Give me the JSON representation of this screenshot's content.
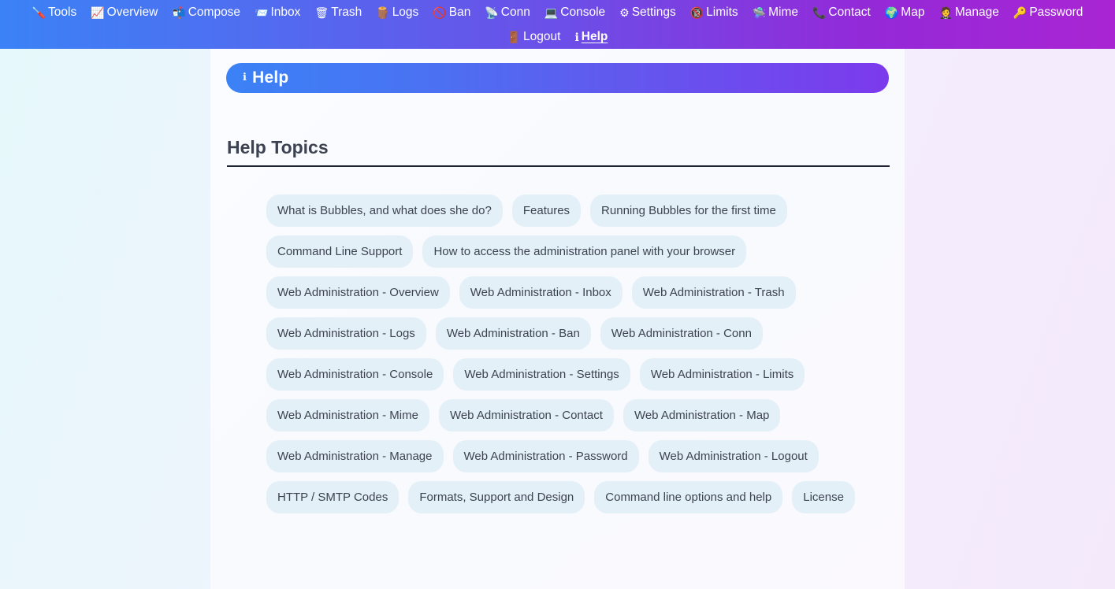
{
  "nav": {
    "row1": [
      {
        "icon": "screwdriver-icon",
        "glyph": "🪛",
        "label": "Tools"
      },
      {
        "icon": "chart-increasing-icon",
        "glyph": "📈",
        "label": "Overview"
      },
      {
        "icon": "open-mailbox-icon",
        "glyph": "📬",
        "label": "Compose"
      },
      {
        "icon": "incoming-envelope-icon",
        "glyph": "📨",
        "label": "Inbox"
      },
      {
        "icon": "wastebasket-icon",
        "glyph": "🗑",
        "label": "Trash"
      },
      {
        "icon": "wood-log-icon",
        "glyph": "🪵",
        "label": "Logs"
      },
      {
        "icon": "prohibited-icon",
        "glyph": "🚫",
        "label": "Ban"
      },
      {
        "icon": "satellite-antenna-icon",
        "glyph": "📡",
        "label": "Conn"
      },
      {
        "icon": "laptop-icon",
        "glyph": "💻",
        "label": "Console"
      },
      {
        "icon": "gear-icon",
        "glyph": "⚙",
        "label": "Settings"
      },
      {
        "icon": "no-one-under-eighteen-icon",
        "glyph": "🔞",
        "label": "Limits"
      },
      {
        "icon": "flying-saucer-icon",
        "glyph": "🛸",
        "label": "Mime"
      },
      {
        "icon": "telephone-receiver-icon",
        "glyph": "📞",
        "label": "Contact"
      },
      {
        "icon": "globe-icon",
        "glyph": "🌍",
        "label": "Map"
      },
      {
        "icon": "person-in-suit-icon",
        "glyph": "🤵",
        "label": "Manage"
      },
      {
        "icon": "key-icon",
        "glyph": "🔑",
        "label": "Password"
      }
    ],
    "row2": [
      {
        "icon": "door-icon",
        "glyph": "🚪",
        "label": "Logout",
        "active": false
      },
      {
        "icon": "information-icon",
        "glyph": "ℹ",
        "label": "Help",
        "active": true
      }
    ]
  },
  "banner": {
    "icon": "information-icon",
    "glyph": "ℹ",
    "title": "Help"
  },
  "main": {
    "section_title": "Help Topics",
    "topics": [
      "What is Bubbles, and what does she do?",
      "Features",
      "Running Bubbles for the first time",
      "Command Line Support",
      "How to access the administration panel with your browser",
      "Web Administration - Overview",
      "Web Administration - Inbox",
      "Web Administration - Trash",
      "Web Administration - Logs",
      "Web Administration - Ban",
      "Web Administration - Conn",
      "Web Administration - Console",
      "Web Administration - Settings",
      "Web Administration - Limits",
      "Web Administration - Mime",
      "Web Administration - Contact",
      "Web Administration - Map",
      "Web Administration - Manage",
      "Web Administration - Password",
      "Web Administration - Logout",
      "HTTP / SMTP Codes",
      "Formats, Support and Design",
      "Command line options and help",
      "License"
    ]
  },
  "colors": {
    "nav_gradient_start": "#3b82f6",
    "nav_gradient_end": "#a925d4",
    "banner_gradient_start": "#3b82f6",
    "banner_gradient_end": "#7c3aed",
    "pill_bg": "#e3f0f8",
    "pill_text": "#3d4350",
    "section_rule": "#1d2330"
  }
}
